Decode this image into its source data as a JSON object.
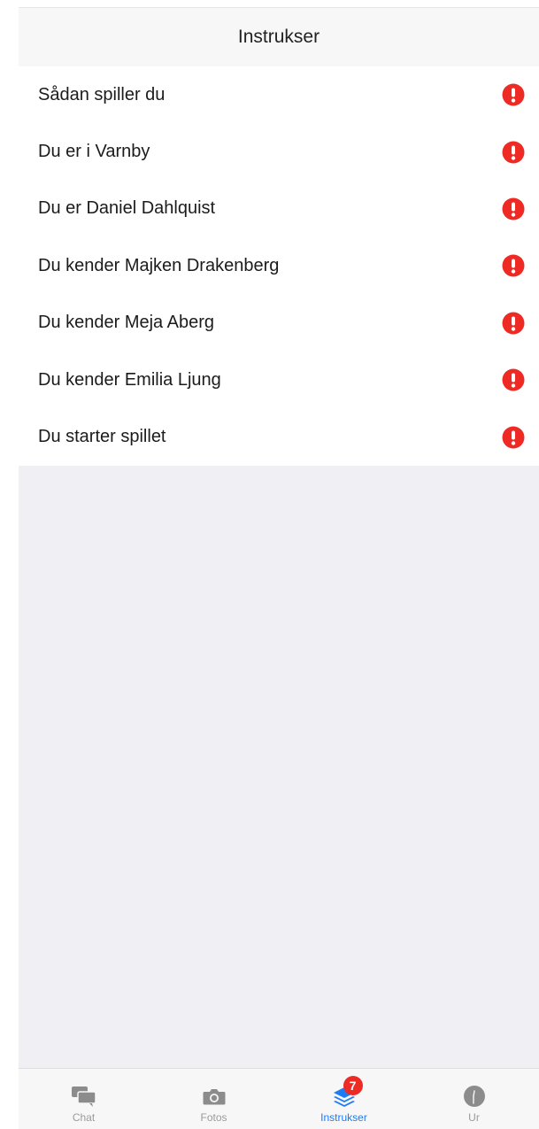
{
  "header": {
    "title": "Instrukser"
  },
  "instructions": [
    {
      "label": "Sådan spiller du",
      "icon": "exclamation-circle-icon"
    },
    {
      "label": "Du er i Varnby",
      "icon": "exclamation-circle-icon"
    },
    {
      "label": "Du er Daniel Dahlquist",
      "icon": "exclamation-circle-icon"
    },
    {
      "label": "Du kender Majken Drakenberg",
      "icon": "exclamation-circle-icon"
    },
    {
      "label": "Du kender Meja Aberg",
      "icon": "exclamation-circle-icon"
    },
    {
      "label": "Du kender Emilia Ljung",
      "icon": "exclamation-circle-icon"
    },
    {
      "label": "Du starter spillet",
      "icon": "exclamation-circle-icon"
    }
  ],
  "tabs": [
    {
      "label": "Chat",
      "icon": "chat-bubbles-icon",
      "active": false
    },
    {
      "label": "Fotos",
      "icon": "camera-icon",
      "active": false
    },
    {
      "label": "Instrukser",
      "icon": "layers-icon",
      "active": true,
      "badge": "7"
    },
    {
      "label": "Ur",
      "icon": "clock-icon",
      "active": false
    }
  ],
  "colors": {
    "alert": "#ee2a25",
    "active_tab": "#1e7cf2",
    "inactive_tab": "#9a9a9a",
    "background": "#efeff4"
  }
}
